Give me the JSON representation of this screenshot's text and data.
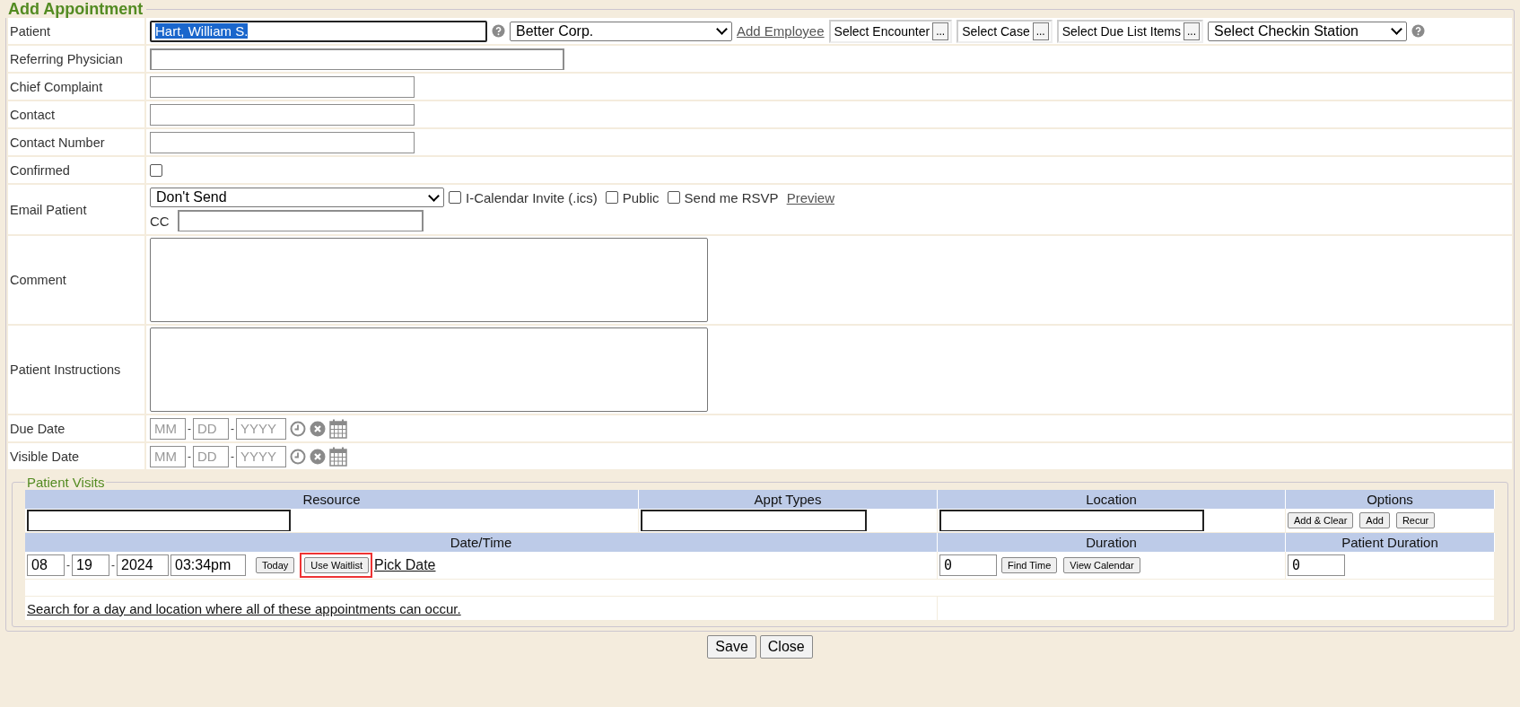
{
  "title": "Add Appointment",
  "patient": {
    "label": "Patient",
    "value": "Hart, William S.",
    "value_selected": true,
    "employer": "Better Corp.",
    "add_employee": "Add Employee",
    "checkin_station": "Select Checkin Station",
    "pickers": [
      {
        "label": "Select Encounter",
        "button": "..."
      },
      {
        "label": "Select Case",
        "button": "..."
      },
      {
        "label": "Select Due List Items",
        "button": "..."
      }
    ]
  },
  "text_rows": [
    {
      "label": "Referring Physician",
      "kind": "wide"
    },
    {
      "label": "Chief Complaint",
      "kind": "short"
    },
    {
      "label": "Contact",
      "kind": "short"
    },
    {
      "label": "Contact Number",
      "kind": "short"
    }
  ],
  "confirmed": {
    "label": "Confirmed",
    "checked": false
  },
  "email": {
    "label": "Email Patient",
    "option": "Don't Send",
    "cc_label": "CC",
    "preview": "Preview",
    "options": [
      {
        "label": "I-Calendar Invite (.ics)",
        "checked": false
      },
      {
        "label": "Public",
        "checked": false
      },
      {
        "label": "Send me RSVP",
        "checked": false
      }
    ]
  },
  "text_areas": [
    {
      "label": "Comment"
    },
    {
      "label": "Patient Instructions"
    }
  ],
  "date_rows": [
    {
      "label": "Due Date",
      "separator": "-",
      "placeholders": [
        "MM",
        "DD",
        "YYYY"
      ]
    },
    {
      "label": "Visible Date",
      "separator": "-",
      "placeholders": [
        "MM",
        "DD",
        "YYYY"
      ]
    }
  ],
  "visits": {
    "legend": "Patient Visits",
    "columns": [
      "Resource",
      "Appt Types",
      "Location",
      "Options"
    ],
    "option_buttons": [
      "Add & Clear",
      "Add",
      "Recur"
    ],
    "columns_2": [
      "Date/Time",
      "Duration",
      "Patient Duration"
    ],
    "date_parts": [
      "08",
      "19",
      "2024"
    ],
    "separator": "-",
    "time": "03:34pm",
    "date_buttons": [
      {
        "label": "Today",
        "highlighted": false
      },
      {
        "label": "Use Waitlist",
        "highlighted": true
      }
    ],
    "pick_date": "Pick Date",
    "duration": "0",
    "duration_buttons": [
      "Find Time",
      "View Calendar"
    ],
    "patient_duration": "0",
    "search_link": "Search for a day and location where all of these appointments can occur."
  },
  "buttons": [
    "Save",
    "Close"
  ]
}
